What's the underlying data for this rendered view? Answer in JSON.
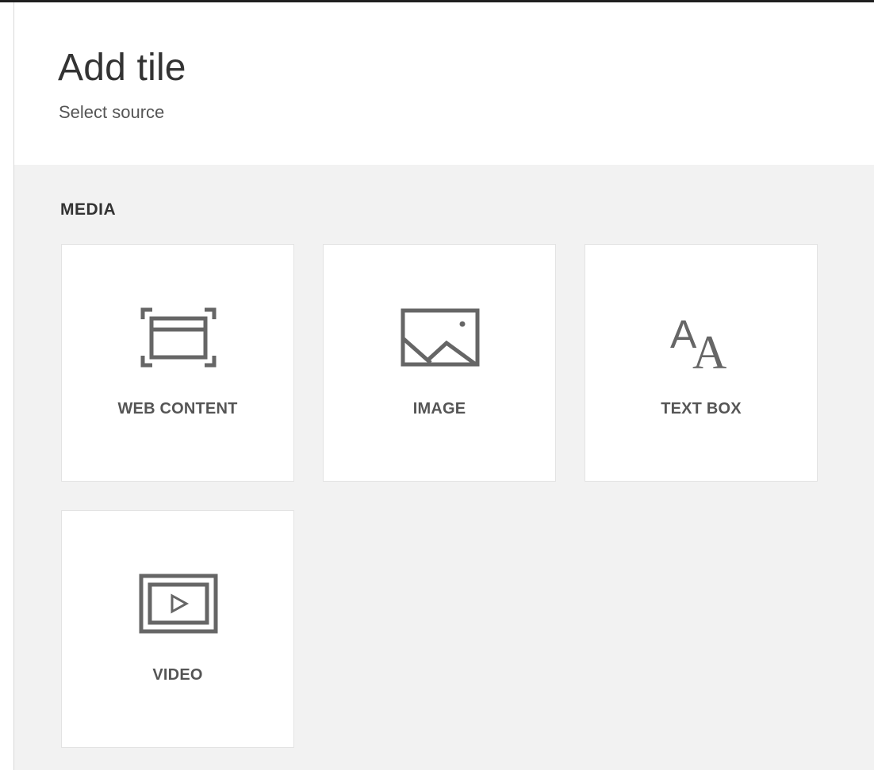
{
  "header": {
    "title": "Add tile",
    "subtitle": "Select source"
  },
  "media_section": {
    "heading": "MEDIA",
    "tiles": [
      {
        "label": "WEB CONTENT",
        "icon": "web-content-icon"
      },
      {
        "label": "IMAGE",
        "icon": "image-icon"
      },
      {
        "label": "TEXT BOX",
        "icon": "text-box-icon"
      },
      {
        "label": "VIDEO",
        "icon": "video-icon"
      }
    ]
  },
  "colors": {
    "icon_gray": "#666666",
    "panel_background": "#f2f2f2",
    "tile_background": "#ffffff"
  }
}
